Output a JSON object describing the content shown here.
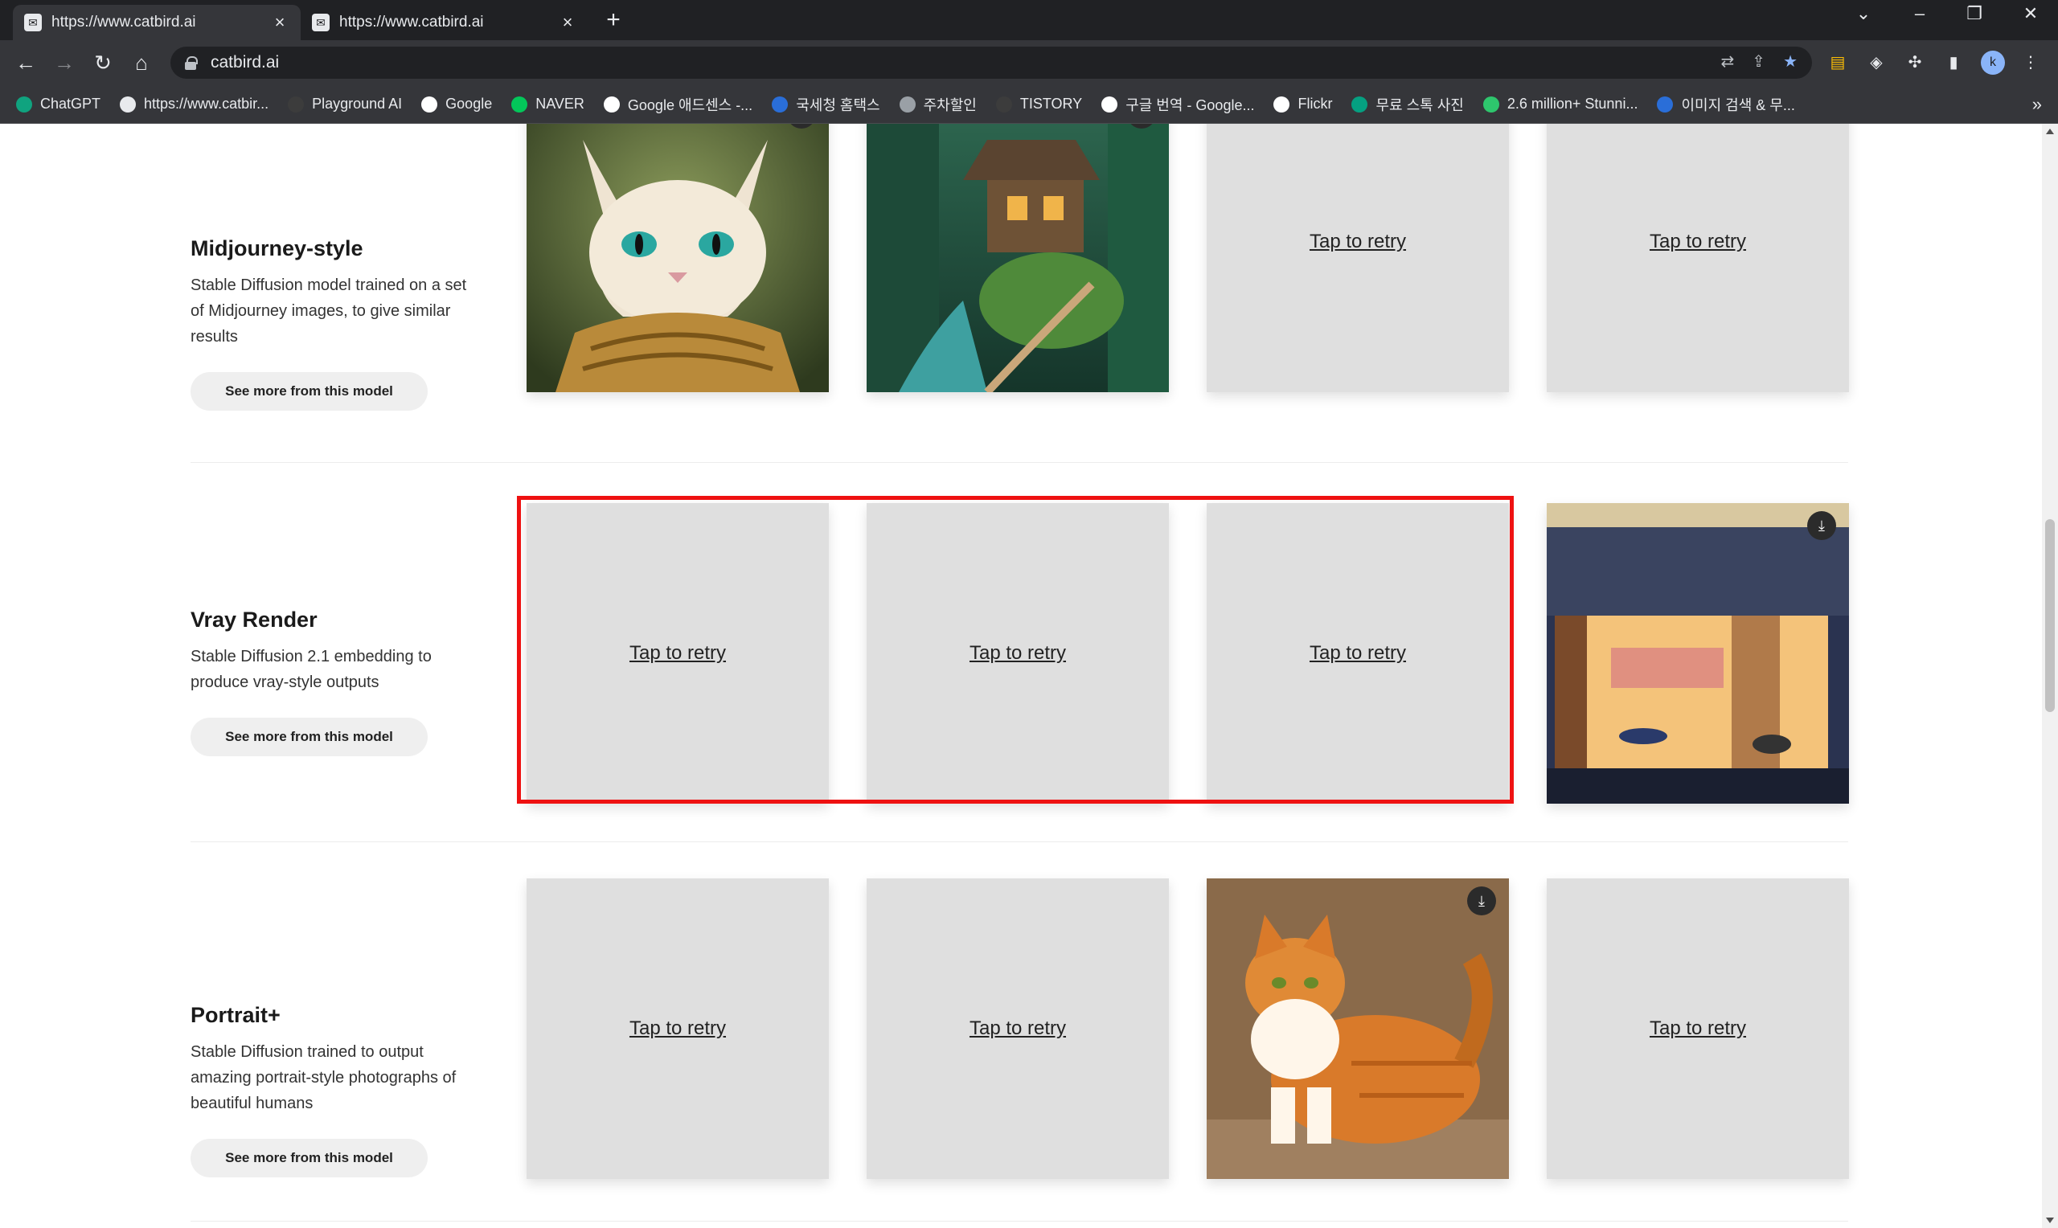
{
  "browser": {
    "tabs": [
      {
        "title": "https://www.catbird.ai",
        "active": true
      },
      {
        "title": "https://www.catbird.ai",
        "active": false
      }
    ],
    "url": "catbird.ai",
    "profile_initial": "k",
    "bookmarks": [
      {
        "label": "ChatGPT",
        "icon": "chatgpt-icon",
        "color": "#10a37f"
      },
      {
        "label": "https://www.catbir...",
        "icon": "catbird-icon",
        "color": "#e8eaed"
      },
      {
        "label": "Playground AI",
        "icon": "playground-icon",
        "color": "#3c3c3c"
      },
      {
        "label": "Google",
        "icon": "google-icon",
        "color": "#ffffff"
      },
      {
        "label": "NAVER",
        "icon": "naver-icon",
        "color": "#03c75a"
      },
      {
        "label": "Google 애드센스 -...",
        "icon": "google-icon",
        "color": "#ffffff"
      },
      {
        "label": "국세청 홈택스",
        "icon": "hometax-icon",
        "color": "#2a6ed8"
      },
      {
        "label": "주차할인",
        "icon": "globe-icon",
        "color": "#9aa0a6"
      },
      {
        "label": "TISTORY",
        "icon": "tistory-icon",
        "color": "#3c3c3c"
      },
      {
        "label": "구글 번역 - Google...",
        "icon": "google-icon",
        "color": "#ffffff"
      },
      {
        "label": "Flickr",
        "icon": "flickr-icon",
        "color": "#ffffff"
      },
      {
        "label": "무료 스톡 사진",
        "icon": "pexels-icon",
        "color": "#05a081"
      },
      {
        "label": "2.6 million+ Stunni...",
        "icon": "pixabay-icon",
        "color": "#2ec66d"
      },
      {
        "label": "이미지 검색 & 무...",
        "icon": "ph-icon",
        "color": "#2a6ed8"
      }
    ]
  },
  "models": [
    {
      "name": "Midjourney-style",
      "description": "Stable Diffusion model trained on a set of Midjourney images, to give similar results",
      "button": "See more from this model",
      "cards": [
        {
          "type": "image",
          "image": "cat-with-scales",
          "download": true
        },
        {
          "type": "image",
          "image": "forest-treehouse",
          "download": true
        },
        {
          "type": "retry",
          "label": "Tap to retry"
        },
        {
          "type": "retry",
          "label": "Tap to retry"
        }
      ]
    },
    {
      "name": "Vray Render",
      "description": "Stable Diffusion 2.1 embedding to produce vray-style outputs",
      "button": "See more from this model",
      "cards": [
        {
          "type": "retry",
          "label": "Tap to retry"
        },
        {
          "type": "retry",
          "label": "Tap to retry"
        },
        {
          "type": "retry",
          "label": "Tap to retry"
        },
        {
          "type": "image",
          "image": "modern-interior-render",
          "download": true
        }
      ]
    },
    {
      "name": "Portrait+",
      "description": "Stable Diffusion trained to output amazing portrait-style photographs of beautiful humans",
      "button": "See more from this model",
      "cards": [
        {
          "type": "retry",
          "label": "Tap to retry"
        },
        {
          "type": "retry",
          "label": "Tap to retry"
        },
        {
          "type": "image",
          "image": "orange-tabby-cat",
          "download": true
        },
        {
          "type": "retry",
          "label": "Tap to retry"
        }
      ]
    }
  ],
  "highlight_color": "#ee1111"
}
